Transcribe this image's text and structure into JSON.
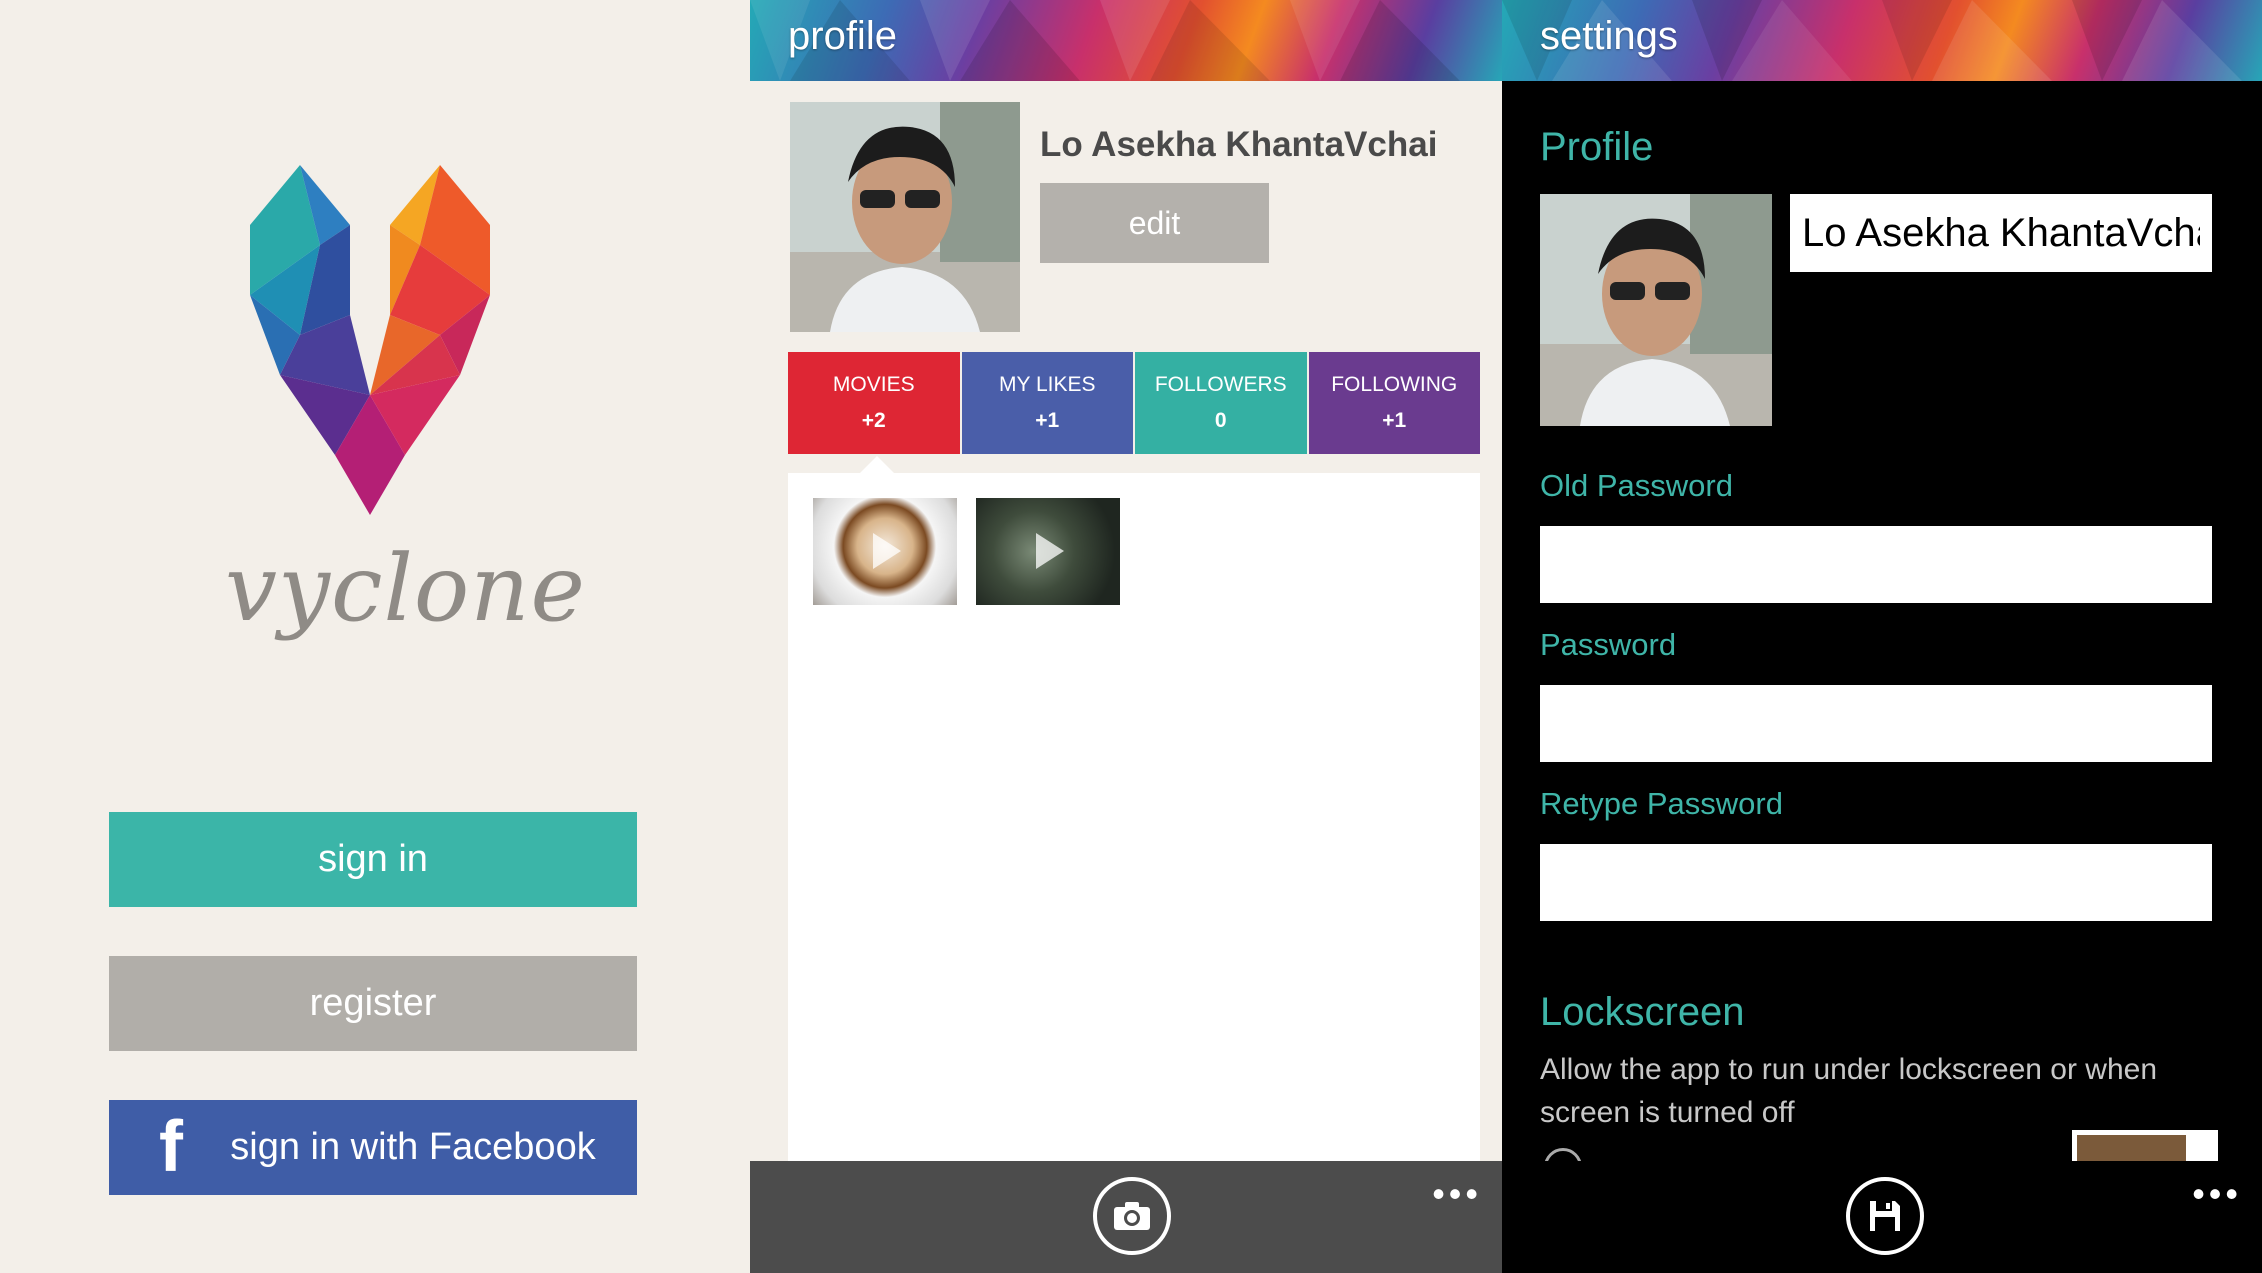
{
  "login": {
    "app_name": "vyclone",
    "sign_in_label": "sign in",
    "register_label": "register",
    "facebook_glyph": "f",
    "facebook_label": "sign in with Facebook",
    "colors": {
      "sign_in": "#3bb5a8",
      "register": "#b1aea9",
      "facebook": "#3f5da7"
    }
  },
  "profile": {
    "title": "profile",
    "user_name": "Lo Asekha KhantaVchai",
    "edit_label": "edit",
    "stats": [
      {
        "label": "MOVIES",
        "count": "+2",
        "color": "#de2634"
      },
      {
        "label": "MY LIKES",
        "count": "+1",
        "color": "#4a5ea9"
      },
      {
        "label": "FOLLOWERS",
        "count": "0",
        "color": "#34b0a3"
      },
      {
        "label": "FOLLOWING",
        "count": "+1",
        "color": "#6a3b8f"
      }
    ],
    "appbar": {
      "main_icon": "camera-icon",
      "more": "•••"
    }
  },
  "settings": {
    "title": "settings",
    "profile_section": "Profile",
    "name_value": "Lo Asekha KhantaVcha",
    "old_password_label": "Old Password",
    "password_label": "Password",
    "retype_password_label": "Retype Password",
    "lockscreen_title": "Lockscreen",
    "lockscreen_desc": "Allow the app to run under lockscreen or when screen is turned off",
    "appbar": {
      "main_icon": "save-icon",
      "more": "•••"
    }
  }
}
